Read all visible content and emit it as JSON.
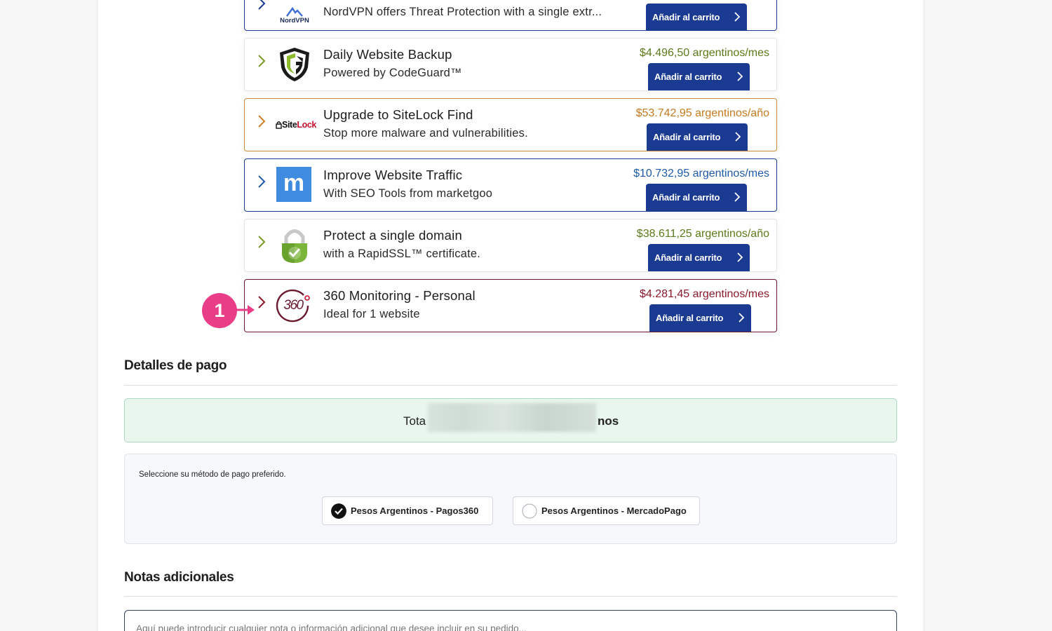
{
  "addons": [
    {
      "id": "nordvpn",
      "logo_text": "NordVPN",
      "title": "",
      "description": "NordVPN offers Threat Protection with a single extr...",
      "price": "",
      "button_label": "Añadir al carrito",
      "border_color": "#1b3a92",
      "price_color": "#1b3a92"
    },
    {
      "id": "codeguard",
      "logo_text": "",
      "title": "Daily Website Backup",
      "description": "Powered by CodeGuard™",
      "price": "$4.496,50 argentinos/mes",
      "button_label": "Añadir al carrito",
      "border_color": "#e2e4ea",
      "price_color": "#5b7a1a"
    },
    {
      "id": "sitelock",
      "logo_text": "SiteLock",
      "title": "Upgrade to SiteLock Find",
      "description": "Stop more malware and vulnerabilities.",
      "price": "$53.742,95 argentinos/año",
      "button_label": "Añadir al carrito",
      "border_color": "#c98a3a",
      "price_color": "#c47a1e"
    },
    {
      "id": "marketgoo",
      "logo_text": "m",
      "title": "Improve Website Traffic",
      "description": "With SEO Tools from marketgoo",
      "price": "$10.732,95 argentinos/mes",
      "button_label": "Añadir al carrito",
      "border_color": "#1b3a92",
      "price_color": "#1f5aa8"
    },
    {
      "id": "rapidssl",
      "logo_text": "",
      "title": "Protect a single domain",
      "description": "with a RapidSSL™ certificate.",
      "price": "$38.611,25 argentinos/año",
      "button_label": "Añadir al carrito",
      "border_color": "#e2e4ea",
      "price_color": "#5b7a1a"
    },
    {
      "id": "monitoring360",
      "logo_text": "360",
      "title": "360 Monitoring - Personal",
      "description": "Ideal for 1 website",
      "price": "$4.281,45 argentinos/mes",
      "button_label": "Añadir al carrito",
      "border_color": "#6a1a2e",
      "price_color": "#8a1a2a"
    }
  ],
  "payment_details": {
    "heading": "Detalles de pago",
    "total_label": "Tota",
    "total_suffix": "nos",
    "method_hint": "Seleccione su método de pago preferido.",
    "options": [
      {
        "label": "Pesos Argentinos - Pagos360",
        "selected": true
      },
      {
        "label": "Pesos Argentinos - MercadoPago",
        "selected": false
      }
    ]
  },
  "notes": {
    "heading": "Notas adicionales",
    "placeholder": "Aquí puede introducir cualquier nota o información adicional que desee incluir en su pedido..."
  },
  "annotation": {
    "step": "1",
    "color": "#ea3d88"
  }
}
